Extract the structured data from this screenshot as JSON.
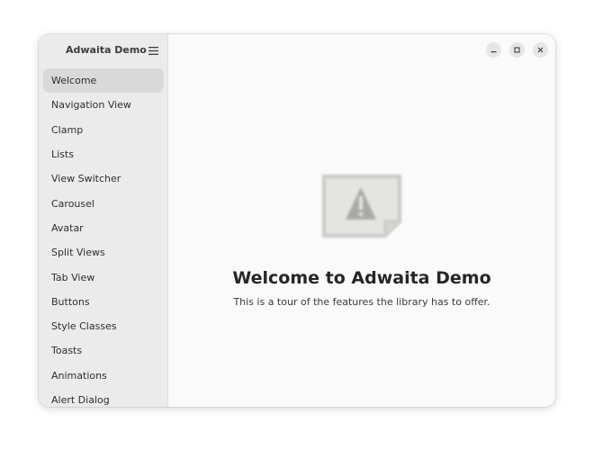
{
  "app": {
    "title": "Adwaita Demo"
  },
  "sidebar": {
    "menu_icon": "hamburger-menu-icon",
    "items": [
      {
        "label": "Welcome",
        "selected": true
      },
      {
        "label": "Navigation View"
      },
      {
        "label": "Clamp"
      },
      {
        "label": "Lists"
      },
      {
        "label": "View Switcher"
      },
      {
        "label": "Carousel"
      },
      {
        "label": "Avatar"
      },
      {
        "label": "Split Views"
      },
      {
        "label": "Tab View"
      },
      {
        "label": "Buttons"
      },
      {
        "label": "Style Classes"
      },
      {
        "label": "Toasts"
      },
      {
        "label": "Animations"
      },
      {
        "label": "Alert Dialog"
      }
    ]
  },
  "window_controls": {
    "minimize_icon": "minimize-icon",
    "maximize_icon": "maximize-icon",
    "close_icon": "close-icon"
  },
  "main": {
    "image_icon": "missing-image-icon",
    "title": "Welcome to Adwaita Demo",
    "description": "This is a tour of the features the library has to offer."
  },
  "colors": {
    "sidebar_bg": "#ebebeb",
    "content_bg": "#fafafa",
    "selected_item_bg": "#d9d9d9",
    "text": "#2e2e2e"
  }
}
